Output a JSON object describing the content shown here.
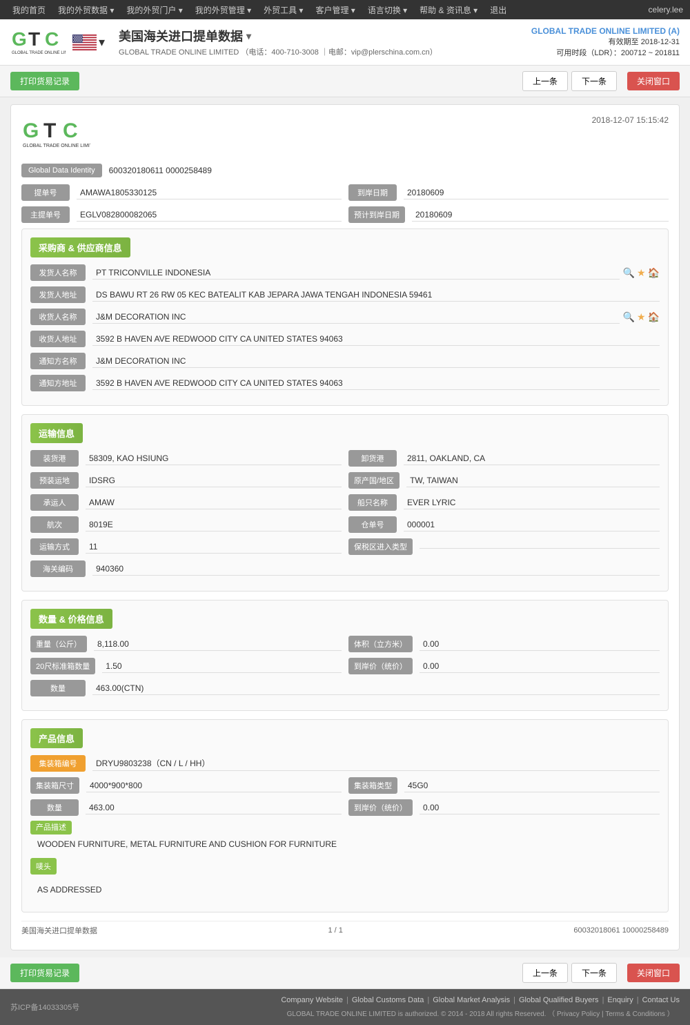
{
  "nav": {
    "items": [
      "我的首页",
      "我的外贸数据 ▾",
      "我的外贸门户 ▾",
      "我的外贸管理 ▾",
      "外贸工具 ▾",
      "客户管理 ▾",
      "语言切换 ▾",
      "帮助 & 资讯息 ▾",
      "退出"
    ],
    "user": "celery.lee"
  },
  "header": {
    "title": "美国海关进口提单数据",
    "company": "GLOBAL TRADE ONLINE LIMITED",
    "phone": "电话：400-710-3008",
    "email": "电邮：vip@plerschina.com.cn",
    "account_name": "GLOBAL TRADE ONLINE LIMITED (A)",
    "valid_until": "有效期至 2018-12-31",
    "ldr": "可用时段（LDR）：200712 ~ 201811"
  },
  "toolbar": {
    "print_label": "打印货易记录",
    "prev_label": "上一条",
    "next_label": "下一条",
    "close_label": "关闭窗口"
  },
  "record": {
    "datetime": "2018-12-07 15:15:42",
    "global_data_id_label": "Global Data Identity",
    "global_data_id": "600320180611 0000258489",
    "bill_no_label": "提单号",
    "bill_no": "AMAWA1805330125",
    "arrival_date_label": "到岸日期",
    "arrival_date": "20180609",
    "master_bill_label": "主提单号",
    "master_bill": "EGLV082800082065",
    "planned_arrival_label": "预计到岸日期",
    "planned_arrival": "20180609",
    "sections": {
      "buyer_supplier": {
        "title": "采购商 & 供应商信息",
        "shipper_name_label": "发货人名称",
        "shipper_name": "PT TRICONVILLE INDONESIA",
        "shipper_addr_label": "发货人地址",
        "shipper_addr": "DS BAWU RT 26 RW 05 KEC BATEALIT KAB JEPARA JAWA TENGAH INDONESIA 59461",
        "consignee_name_label": "收货人名称",
        "consignee_name": "J&M DECORATION INC",
        "consignee_addr_label": "收货人地址",
        "consignee_addr": "3592 B HAVEN AVE REDWOOD CITY CA UNITED STATES 94063",
        "notify_name_label": "通知方名称",
        "notify_name": "J&M DECORATION INC",
        "notify_addr_label": "通知方地址",
        "notify_addr": "3592 B HAVEN AVE REDWOOD CITY CA UNITED STATES 94063"
      },
      "transport": {
        "title": "运输信息",
        "load_port_label": "装货港",
        "load_port": "58309, KAO HSIUNG",
        "unload_port_label": "卸货港",
        "unload_port": "2811, OAKLAND, CA",
        "preload_dest_label": "预装运地",
        "preload_dest": "IDSRG",
        "origin_country_label": "原产国/地区",
        "origin_country": "TW, TAIWAN",
        "carrier_label": "承运人",
        "carrier": "AMAW",
        "vessel_name_label": "船只名称",
        "vessel_name": "EVER LYRIC",
        "voyage_label": "航次",
        "voyage": "8019E",
        "manifest_label": "仓单号",
        "manifest": "000001",
        "transport_mode_label": "运输方式",
        "transport_mode": "11",
        "bonded_label": "保税区进入类型",
        "bonded": "",
        "hs_code_label": "海关编码",
        "hs_code": "940360"
      },
      "quantity": {
        "title": "数量 & 价格信息",
        "weight_label": "重量（公斤）",
        "weight": "8,118.00",
        "volume_label": "体积（立方米）",
        "volume": "0.00",
        "teu_label": "20尺标准箱数量",
        "teu": "1.50",
        "unit_price_label": "到岸价（统价）",
        "unit_price": "0.00",
        "quantity_label": "数量",
        "quantity": "463.00(CTN)"
      },
      "product": {
        "title": "产品信息",
        "container_no_label": "集装箱编号",
        "container_no": "DRYU9803238（CN / L / HH）",
        "container_size_label": "集装箱尺寸",
        "container_size": "4000*900*800",
        "container_type_label": "集装箱类型",
        "container_type": "45G0",
        "quantity_label": "数量",
        "quantity": "463.00",
        "unit_price_label": "到岸价（统价）",
        "unit_price": "0.00",
        "desc_label": "产品描述",
        "desc": "WOODEN FURNITURE, METAL FURNITURE AND CUSHION FOR FURNITURE",
        "mark_label": "唛头",
        "mark": "AS ADDRESSED"
      }
    },
    "record_info": {
      "source": "美国海关进口提单数据",
      "page": "1 / 1",
      "id": "60032018061 10000258489"
    }
  },
  "footer": {
    "icp": "苏ICP备14033305号",
    "links": [
      "Company Website",
      "Global Customs Data",
      "Global Market Analysis",
      "Global Qualified Buyers",
      "Enquiry",
      "Contact Us"
    ],
    "copyright": "GLOBAL TRADE ONLINE LIMITED is authorized. © 2014 - 2018 All rights Reserved.  （ Privacy Policy | Terms & Conditions ）"
  }
}
